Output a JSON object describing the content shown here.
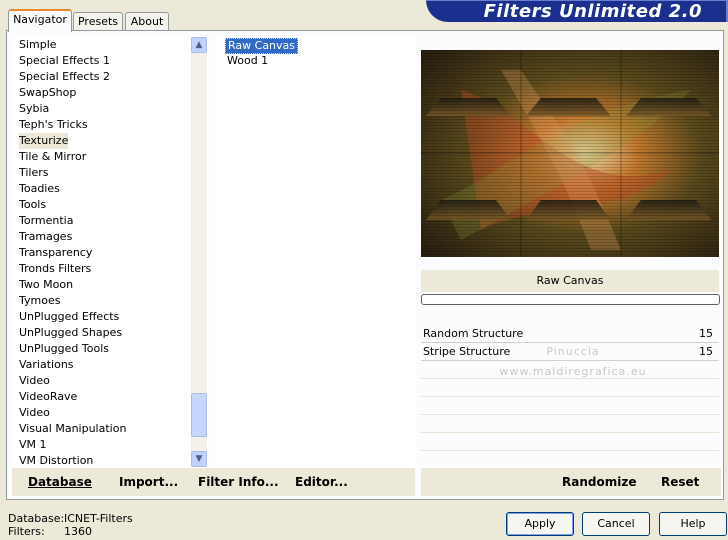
{
  "app": {
    "title": "Filters Unlimited 2.0"
  },
  "tabs": [
    {
      "label": "Navigator",
      "active": true
    },
    {
      "label": "Presets",
      "active": false
    },
    {
      "label": "About",
      "active": false
    }
  ],
  "categories": [
    "Simple",
    "Special Effects 1",
    "Special Effects 2",
    "SwapShop",
    "Sybia",
    "Teph's Tricks",
    "Texturize",
    "Tile & Mirror",
    "Tilers",
    "Toadies",
    "Tools",
    "Tormentia",
    "Tramages",
    "Transparency",
    "Tronds Filters",
    "Two Moon",
    "Tymoes",
    "UnPlugged Effects",
    "UnPlugged Shapes",
    "UnPlugged Tools",
    "Variations",
    "Video",
    "VideoRave",
    "Video",
    "Visual Manipulation",
    "VM 1",
    "VM Distortion"
  ],
  "selected_category": "Texturize",
  "filters": [
    "Raw Canvas",
    "Wood 1"
  ],
  "selected_filter": "Raw Canvas",
  "preview": {
    "filter_name": "Raw Canvas",
    "progress": 0
  },
  "params": [
    {
      "label": "Random Structure",
      "value": "15"
    },
    {
      "label": "Stripe Structure",
      "value": "15"
    }
  ],
  "watermark": {
    "line1": "Pinuccia",
    "line2": "www.maldiregrafica.eu"
  },
  "left_bar": {
    "database": "Database",
    "import": "Import...",
    "filter_info": "Filter Info...",
    "editor": "Editor..."
  },
  "right_bar": {
    "randomize": "Randomize",
    "reset": "Reset"
  },
  "status": {
    "database_label": "Database:",
    "database_value": "ICNET-Filters",
    "filters_label": "Filters:",
    "filters_value": "1360"
  },
  "dialog": {
    "apply": "Apply",
    "cancel": "Cancel",
    "help": "Help"
  }
}
